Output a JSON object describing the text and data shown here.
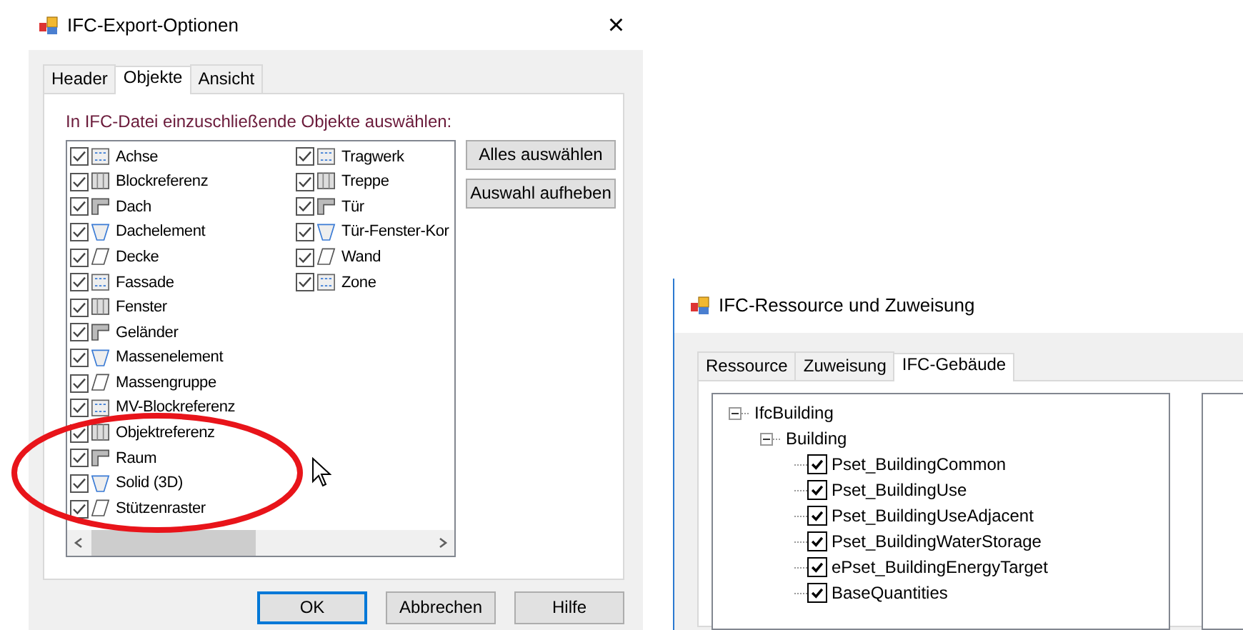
{
  "export_dialog": {
    "title": "IFC-Export-Optionen",
    "close": "×",
    "tabs": [
      {
        "label": "Header",
        "selected": false
      },
      {
        "label": "Objekte",
        "selected": true
      },
      {
        "label": "Ansicht",
        "selected": false
      }
    ],
    "instruction": "In IFC-Datei einzuschließende Objekte auswählen:",
    "object_columns": [
      [
        {
          "label": "Achse",
          "checked": true
        },
        {
          "label": "Blockreferenz",
          "checked": true
        },
        {
          "label": "Dach",
          "checked": true
        },
        {
          "label": "Dachelement",
          "checked": true
        },
        {
          "label": "Decke",
          "checked": true
        },
        {
          "label": "Fassade",
          "checked": true
        },
        {
          "label": "Fenster",
          "checked": true
        },
        {
          "label": "Geländer",
          "checked": true
        },
        {
          "label": "Massenelement",
          "checked": true
        },
        {
          "label": "Massengruppe",
          "checked": true
        },
        {
          "label": "MV-Blockreferenz",
          "checked": true
        },
        {
          "label": "Objektreferenz",
          "checked": true
        },
        {
          "label": "Raum",
          "checked": true
        },
        {
          "label": "Solid (3D)",
          "checked": true
        },
        {
          "label": "Stützenraster",
          "checked": true
        }
      ],
      [
        {
          "label": "Tragwerk",
          "checked": true
        },
        {
          "label": "Treppe",
          "checked": true
        },
        {
          "label": "Tür",
          "checked": true
        },
        {
          "label": "Tür-Fenster-Kor",
          "checked": true
        },
        {
          "label": "Wand",
          "checked": true
        },
        {
          "label": "Zone",
          "checked": true
        }
      ]
    ],
    "side_buttons": [
      "Alles auswählen",
      "Auswahl aufheben"
    ],
    "footer_buttons": [
      {
        "label": "OK",
        "default": true
      },
      {
        "label": "Abbrechen",
        "default": false
      },
      {
        "label": "Hilfe",
        "default": false
      }
    ]
  },
  "resource_dialog": {
    "title": "IFC-Ressource und Zuweisung",
    "tabs": [
      {
        "label": "Ressource",
        "selected": false
      },
      {
        "label": "Zuweisung",
        "selected": false
      },
      {
        "label": "IFC-Gebäude",
        "selected": true
      }
    ],
    "tree": [
      {
        "label": "IfcBuilding",
        "expanded": true,
        "children": [
          {
            "label": "Building",
            "expanded": true,
            "children": [
              {
                "label": "Pset_BuildingCommon",
                "checked": true
              },
              {
                "label": "Pset_BuildingUse",
                "checked": true
              },
              {
                "label": "Pset_BuildingUseAdjacent",
                "checked": true
              },
              {
                "label": "Pset_BuildingWaterStorage",
                "checked": true
              },
              {
                "label": "ePset_BuildingEnergyTarget",
                "checked": true
              },
              {
                "label": "BaseQuantities",
                "checked": true
              }
            ]
          }
        ]
      }
    ]
  }
}
